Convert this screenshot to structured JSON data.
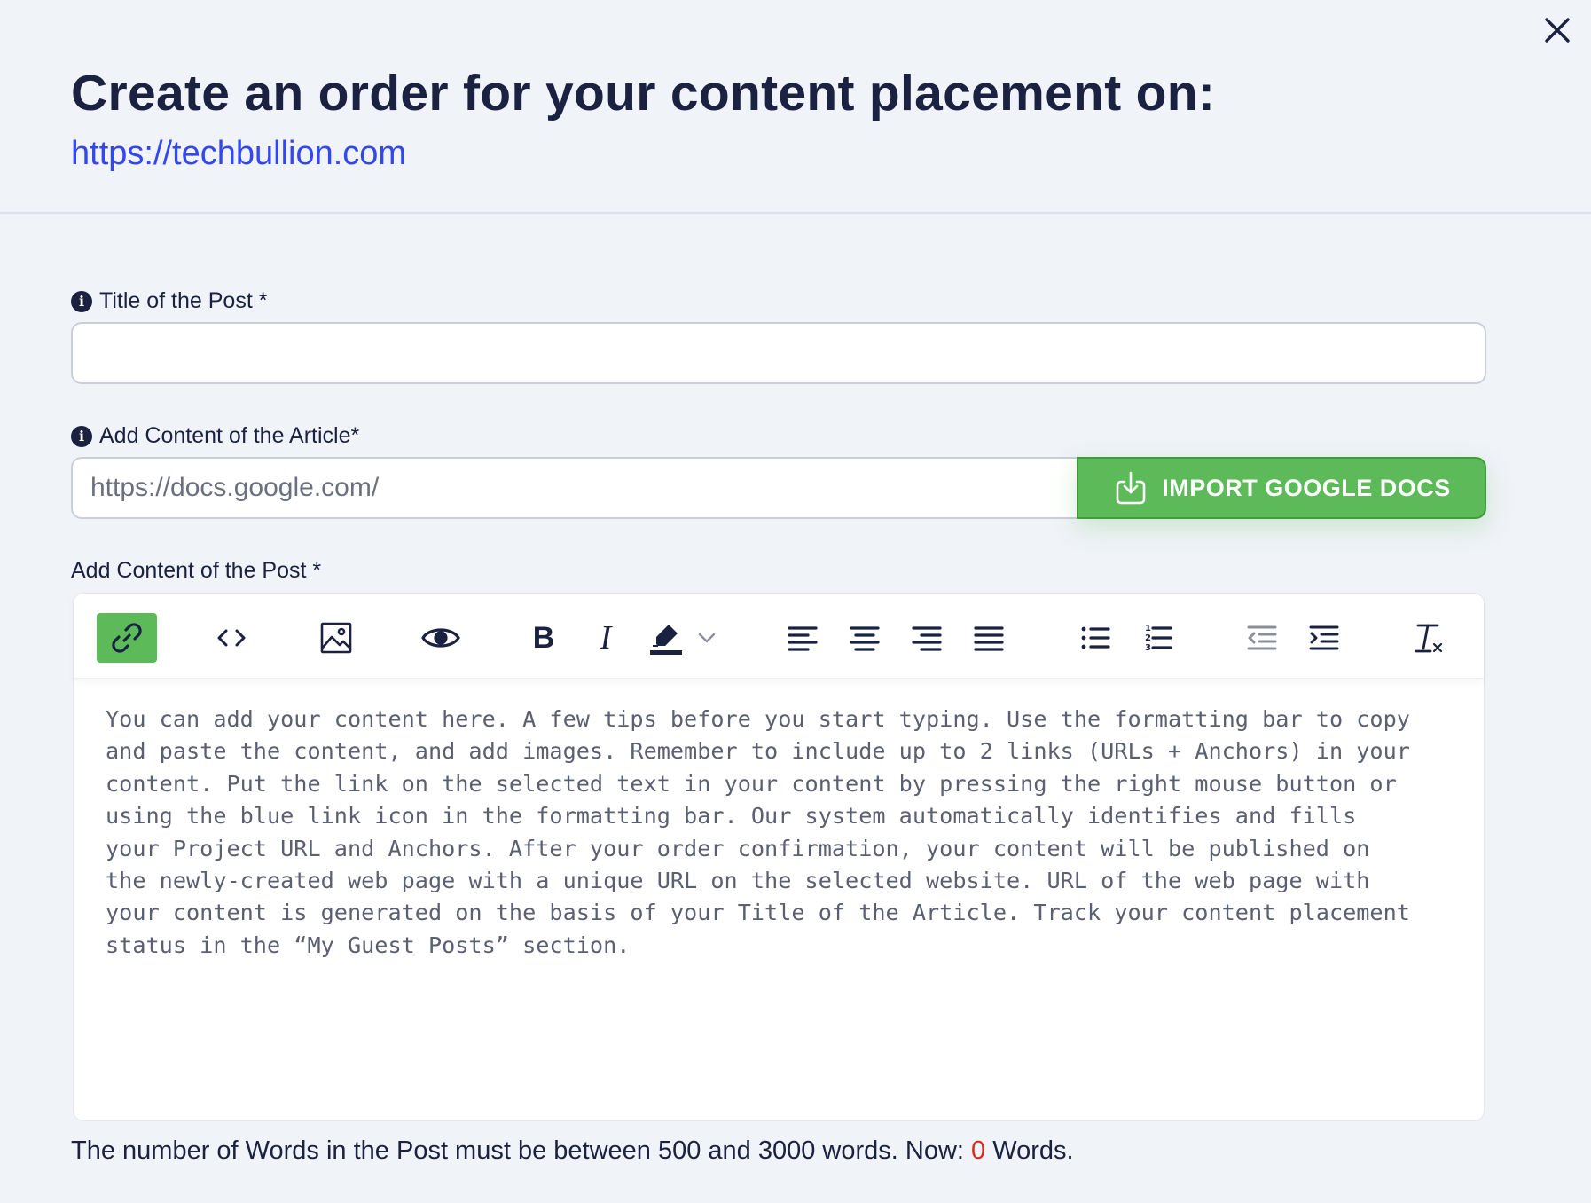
{
  "header": {
    "title": "Create an order for your content placement on:",
    "site_url": "https://techbullion.com"
  },
  "title_field": {
    "label": "Title of the Post *",
    "value": "",
    "placeholder": ""
  },
  "article_field": {
    "label": "Add Content of the Article*",
    "placeholder": "https://docs.google.com/",
    "import_button_label": "IMPORT GOOGLE DOCS"
  },
  "post_field": {
    "label": "Add Content of the Post *",
    "toolbar": [
      {
        "icon": "link-icon",
        "active": true
      },
      {
        "icon": "code-icon",
        "active": false
      },
      {
        "icon": "image-icon",
        "active": false
      },
      {
        "icon": "preview-eye-icon",
        "active": false
      },
      {
        "icon": "bold-icon",
        "active": false
      },
      {
        "icon": "italic-icon",
        "active": false
      },
      {
        "icon": "highlight-marker-icon",
        "active": false
      },
      {
        "icon": "chevron-down-icon",
        "active": false
      },
      {
        "icon": "align-left-icon",
        "active": false
      },
      {
        "icon": "align-center-icon",
        "active": false
      },
      {
        "icon": "align-right-icon",
        "active": false
      },
      {
        "icon": "align-justify-icon",
        "active": false
      },
      {
        "icon": "bullet-list-icon",
        "active": false
      },
      {
        "icon": "numbered-list-icon",
        "active": false
      },
      {
        "icon": "outdent-icon",
        "active": false
      },
      {
        "icon": "indent-icon",
        "active": false
      },
      {
        "icon": "clear-format-icon",
        "active": false
      }
    ],
    "placeholder_text": "You can add your content here. A few tips before you start typing. Use the formatting bar to copy\nand paste the content, and add images. Remember to include up to 2 links (URLs + Anchors) in your\ncontent. Put the link on the selected text in your content by pressing the right mouse button or\nusing the blue link icon in the formatting bar. Our system automatically identifies and fills\nyour Project URL and Anchors. After your order confirmation, your content will be published on\nthe newly-created web page with a unique URL on the selected website. URL of the web page with\nyour content is generated on the basis of your Title of the Article. Track your content placement\nstatus in the “My Guest Posts” section."
  },
  "word_count": {
    "prefix": "The number of Words in the Post must be between 500 and 3000 words. Now: ",
    "count": "0",
    "suffix": " Words."
  },
  "colors": {
    "accent_green": "#5cba58",
    "link_blue": "#3247f0",
    "count_red": "#e0261f",
    "text_dark": "#1b2140"
  }
}
